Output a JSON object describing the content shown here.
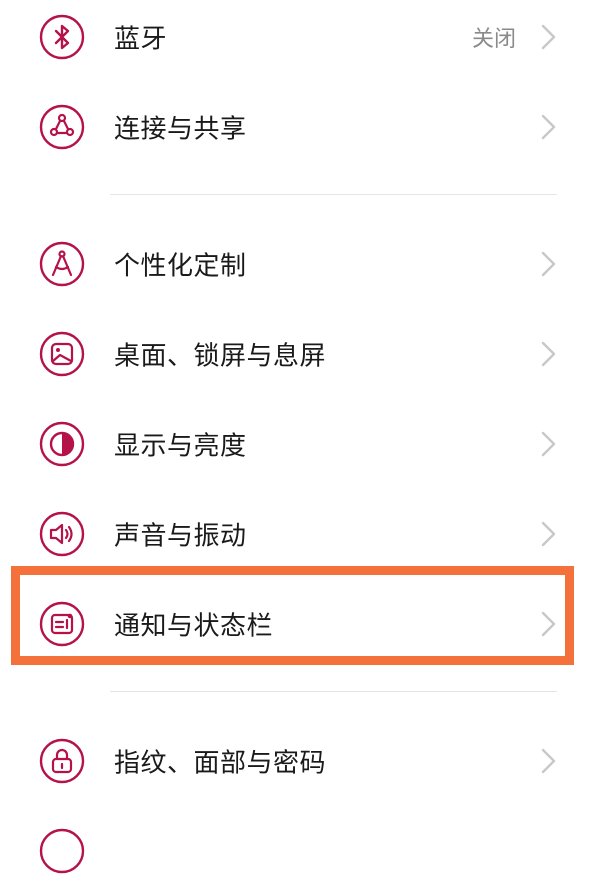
{
  "colors": {
    "icon_accent": "#b5124a",
    "chevron": "#c8c8c8",
    "highlight": "#f4713b",
    "divider": "#e4e4e4"
  },
  "settings": {
    "bluetooth": {
      "label": "蓝牙",
      "value": "关闭",
      "icon": "bluetooth-icon"
    },
    "connection": {
      "label": "连接与共享",
      "icon": "share-network-icon"
    },
    "personalization": {
      "label": "个性化定制",
      "icon": "compass-icon"
    },
    "desktop": {
      "label": "桌面、锁屏与息屏",
      "icon": "wallpaper-icon"
    },
    "display": {
      "label": "显示与亮度",
      "icon": "brightness-icon"
    },
    "sound": {
      "label": "声音与振动",
      "icon": "speaker-icon"
    },
    "notification": {
      "label": "通知与状态栏",
      "icon": "notification-icon",
      "highlighted": true
    },
    "security": {
      "label": "指纹、面部与密码",
      "icon": "lock-icon"
    }
  }
}
